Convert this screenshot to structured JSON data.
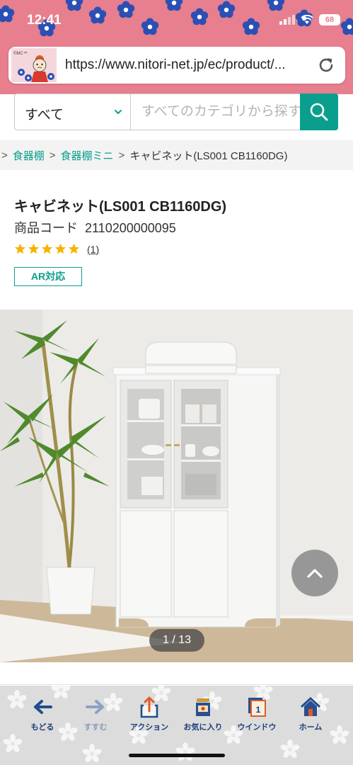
{
  "status_bar": {
    "time": "12:41",
    "battery": "68"
  },
  "browser": {
    "url": "https://www.nitori-net.jp/ec/product/...",
    "logo_caption": "©MC™"
  },
  "search": {
    "category": "すべて",
    "placeholder": "すべてのカテゴリから探す"
  },
  "breadcrumb": {
    "leading_sep": ">",
    "items": [
      {
        "label": "食器棚"
      },
      {
        "label": "食器棚ミニ"
      },
      {
        "label": "キャビネット(LS001 CB1160DG)"
      }
    ],
    "sep": ">"
  },
  "product": {
    "title": "キャビネット(LS001 CB1160DG)",
    "code_label": "商品コード",
    "code_value": "2110200000095",
    "rating_stars": 5,
    "review_count": "(1)",
    "ar_badge": "AR対応"
  },
  "gallery": {
    "counter": "1 / 13"
  },
  "toolbar": {
    "back": "もどる",
    "forward": "すすむ",
    "action": "アクション",
    "favorites": "お気に入り",
    "window": "ウインドウ",
    "window_count": "1",
    "home": "ホーム"
  },
  "colors": {
    "chrome_pink": "#e77f8f",
    "accent_teal": "#0a9f8d",
    "flower_blue": "#2c4fb5",
    "star_gold": "#f5b400",
    "toolbar_label": "#1e3f7a"
  }
}
